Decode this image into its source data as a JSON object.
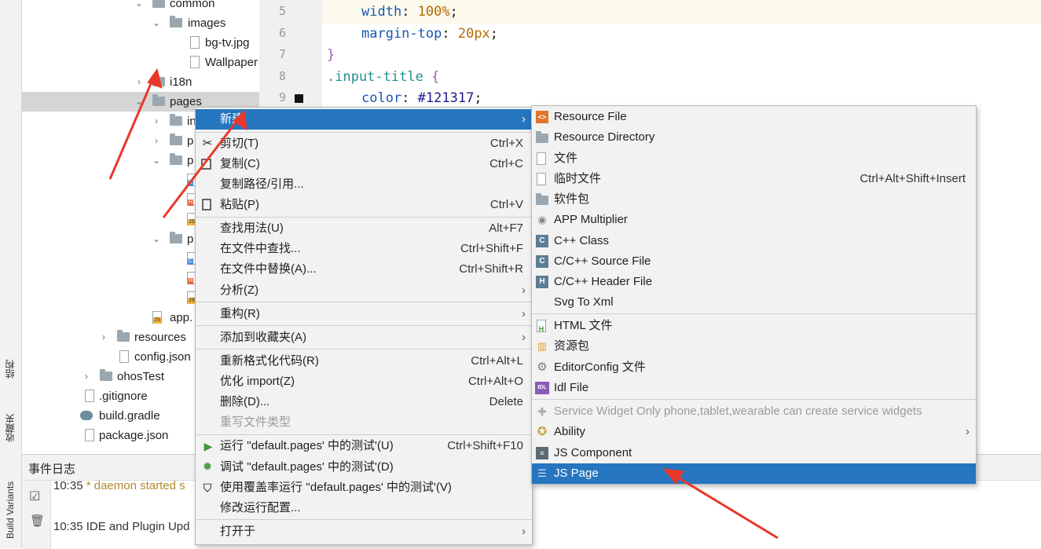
{
  "left_strip": {
    "tab_structure": "结构",
    "tab_favorites": "收藏夹",
    "tab_build_variants": "Build Variants"
  },
  "tree": {
    "items": [
      {
        "label": "common"
      },
      {
        "label": "images"
      },
      {
        "label": "bg-tv.jpg"
      },
      {
        "label": "Wallpaper"
      },
      {
        "label": "i18n"
      },
      {
        "label": "pages"
      },
      {
        "label": "in"
      },
      {
        "label": "p"
      },
      {
        "label": "p"
      },
      {
        "label": "p"
      },
      {
        "label": "app."
      },
      {
        "label": "resources"
      },
      {
        "label": "config.json"
      },
      {
        "label": "ohosTest"
      },
      {
        "label": ".gitignore"
      },
      {
        "label": "build.gradle"
      },
      {
        "label": "package.json"
      }
    ]
  },
  "editor": {
    "line_numbers": [
      "5",
      "6",
      "7",
      "8",
      "9"
    ],
    "lines": [
      {
        "prop": "width",
        "colon": ": ",
        "val": "100%",
        "end": ";"
      },
      {
        "prop": "margin-top",
        "colon": ": ",
        "val": "20px",
        "end": ";"
      },
      {
        "brace": "}"
      },
      {
        "selector": ".input-title",
        "open": " {"
      },
      {
        "prop": "color",
        "colon": ": ",
        "val": "#121317",
        "end": ";"
      }
    ]
  },
  "bottom_panel": {
    "title": "事件日志",
    "log": [
      {
        "time": "10:35",
        "text": "* daemon started s"
      },
      {
        "time": "10:35",
        "text": "IDE and Plugin Upd"
      }
    ]
  },
  "context_menu": {
    "items": [
      {
        "label": "新建",
        "shortcut": "",
        "submenu": true
      },
      {
        "label": "剪切(T)",
        "shortcut": "Ctrl+X",
        "icon": "scissors-icon"
      },
      {
        "label": "复制(C)",
        "shortcut": "Ctrl+C",
        "icon": "copy-icon"
      },
      {
        "label": "复制路径/引用...",
        "shortcut": ""
      },
      {
        "label": "粘贴(P)",
        "shortcut": "Ctrl+V",
        "icon": "paste-icon"
      },
      {
        "label": "查找用法(U)",
        "shortcut": "Alt+F7"
      },
      {
        "label": "在文件中查找...",
        "shortcut": "Ctrl+Shift+F"
      },
      {
        "label": "在文件中替换(A)...",
        "shortcut": "Ctrl+Shift+R"
      },
      {
        "label": "分析(Z)",
        "shortcut": "",
        "submenu": true
      },
      {
        "label": "重构(R)",
        "shortcut": "",
        "submenu": true
      },
      {
        "label": "添加到收藏夹(A)",
        "shortcut": "",
        "submenu": true
      },
      {
        "label": "重新格式化代码(R)",
        "shortcut": "Ctrl+Alt+L"
      },
      {
        "label": "优化 import(Z)",
        "shortcut": "Ctrl+Alt+O"
      },
      {
        "label": "删除(D)...",
        "shortcut": "Delete"
      },
      {
        "label": "重写文件类型",
        "shortcut": "",
        "disabled": true
      },
      {
        "label": "运行 ''default.pages' 中的测试'(U)",
        "shortcut": "Ctrl+Shift+F10",
        "icon": "run-icon"
      },
      {
        "label": "调试 ''default.pages' 中的测试'(D)",
        "shortcut": "",
        "icon": "debug-icon"
      },
      {
        "label": "使用覆盖率运行 ''default.pages' 中的测试'(V)",
        "shortcut": "",
        "icon": "coverage-icon"
      },
      {
        "label": "修改运行配置...",
        "shortcut": ""
      },
      {
        "label": "打开于",
        "shortcut": "",
        "submenu": true
      }
    ]
  },
  "submenu": {
    "items": [
      {
        "label": "Resource File",
        "icon": "resource-file-icon"
      },
      {
        "label": "Resource Directory",
        "icon": "folder-icon"
      },
      {
        "label": "文件",
        "icon": "file-icon"
      },
      {
        "label": "临时文件",
        "shortcut": "Ctrl+Alt+Shift+Insert",
        "icon": "scratch-file-icon"
      },
      {
        "label": "软件包",
        "icon": "package-icon"
      },
      {
        "label": "APP Multiplier",
        "icon": "app-multiplier-icon"
      },
      {
        "label": "C++ Class",
        "icon": "cpp-class-icon"
      },
      {
        "label": "C/C++ Source File",
        "icon": "c-source-icon"
      },
      {
        "label": "C/C++ Header File",
        "icon": "c-header-icon"
      },
      {
        "label": "Svg To Xml",
        "icon": ""
      },
      {
        "label": "HTML 文件",
        "icon": "html-file-icon"
      },
      {
        "label": "资源包",
        "icon": "resource-bundle-icon"
      },
      {
        "label": "EditorConfig 文件",
        "icon": "gear-icon"
      },
      {
        "label": "Idl File",
        "icon": "idl-file-icon"
      },
      {
        "label": "Service Widget Only phone,tablet,wearable can create service widgets",
        "disabled": true,
        "icon": "puzzle-icon"
      },
      {
        "label": "Ability",
        "submenu": true,
        "icon": "ability-icon"
      },
      {
        "label": "JS Component",
        "icon": "js-component-icon"
      },
      {
        "label": "JS Page",
        "icon": "js-page-icon",
        "highlighted": true
      }
    ]
  },
  "colors": {
    "highlight": "#2675bf",
    "annotation_arrow": "#e8382b"
  }
}
